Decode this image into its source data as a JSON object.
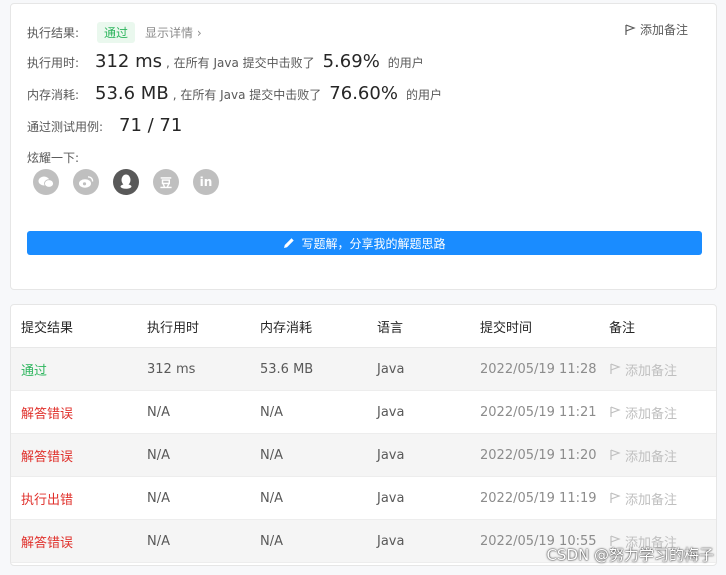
{
  "result": {
    "label": "执行结果:",
    "status": "通过",
    "details_link": "显示详情 ›",
    "add_note": "添加备注"
  },
  "runtime": {
    "label": "执行用时:",
    "value": "312 ms",
    "middle": ", 在所有 Java 提交中击败了",
    "percent": "5.69%",
    "suffix": "的用户"
  },
  "memory": {
    "label": "内存消耗:",
    "value": "53.6 MB",
    "middle": ", 在所有 Java 提交中击败了",
    "percent": "76.60%",
    "suffix": "的用户"
  },
  "tests": {
    "label": "通过测试用例:",
    "value": "71 / 71"
  },
  "share": {
    "label": "炫耀一下:",
    "icons": [
      "wechat-icon",
      "weibo-icon",
      "qq-icon",
      "douban-icon",
      "linkedin-icon"
    ],
    "douban_glyph": "豆",
    "linkedin_glyph": "in"
  },
  "write_solution": "写题解，分享我的解题思路",
  "table": {
    "headers": [
      "提交结果",
      "执行用时",
      "内存消耗",
      "语言",
      "提交时间",
      "备注"
    ],
    "rows": [
      {
        "result": "通过",
        "time": "312 ms",
        "memory": "53.6 MB",
        "lang": "Java",
        "submitted": "2022/05/19 11:28",
        "note": "添加备注"
      },
      {
        "result": "解答错误",
        "time": "N/A",
        "memory": "N/A",
        "lang": "Java",
        "submitted": "2022/05/19 11:21",
        "note": "添加备注"
      },
      {
        "result": "解答错误",
        "time": "N/A",
        "memory": "N/A",
        "lang": "Java",
        "submitted": "2022/05/19 11:20",
        "note": "添加备注"
      },
      {
        "result": "执行出错",
        "time": "N/A",
        "memory": "N/A",
        "lang": "Java",
        "submitted": "2022/05/19 11:19",
        "note": "添加备注"
      },
      {
        "result": "解答错误",
        "time": "N/A",
        "memory": "N/A",
        "lang": "Java",
        "submitted": "2022/05/19 10:55",
        "note": "添加备注"
      }
    ]
  },
  "watermark": "CSDN @努力学习的梅子",
  "colors": {
    "accent": "#1a8cff",
    "pass": "#2db55d",
    "error": "#e0312c"
  }
}
